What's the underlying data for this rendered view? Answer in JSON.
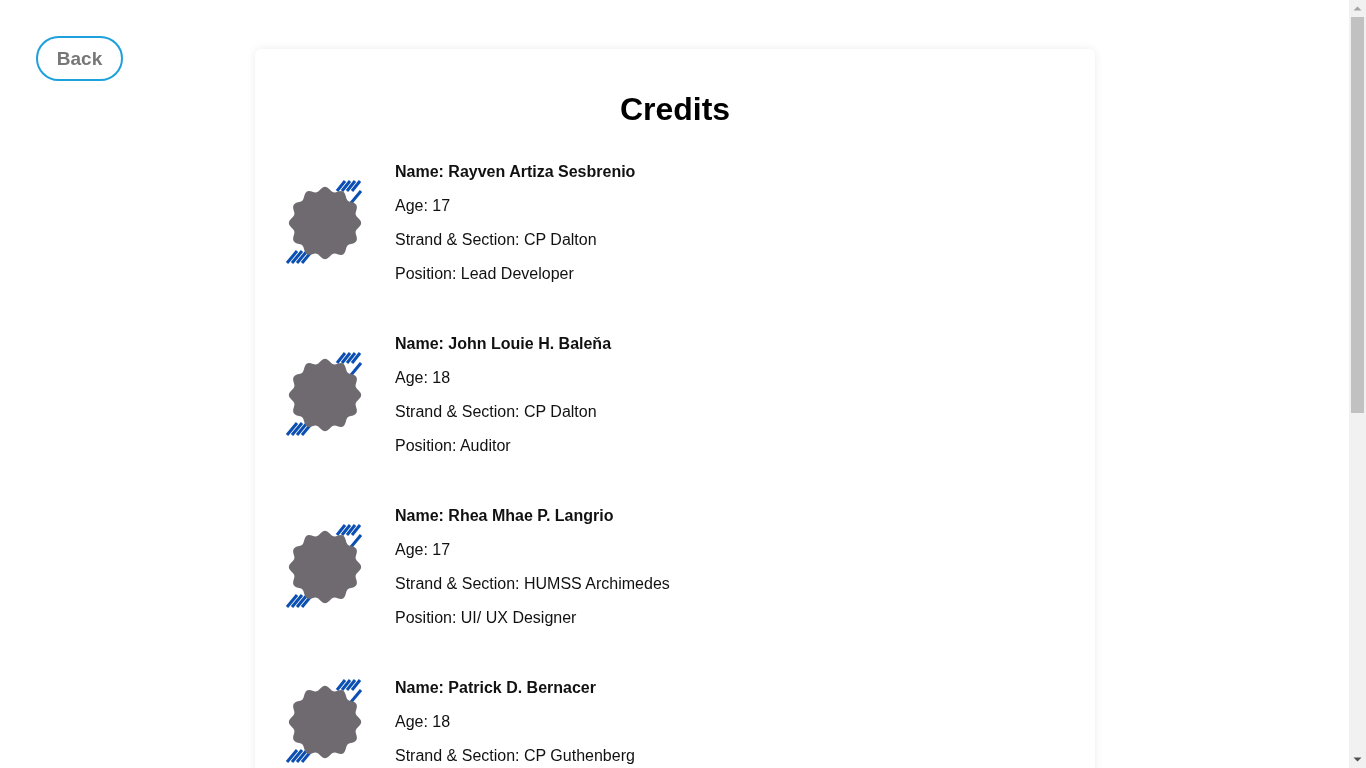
{
  "back_button": {
    "label": "Back"
  },
  "title": "Credits",
  "members": [
    {
      "name": "Name: Rayven Artiza Sesbrenio",
      "details": [
        "Age: 17",
        "Strand & Section: CP Dalton",
        "Position: Lead Developer"
      ]
    },
    {
      "name": "Name: John Louie H. Baleňa",
      "details": [
        "Age: 18",
        "Strand & Section: CP Dalton",
        "Position: Auditor"
      ]
    },
    {
      "name": "Name: Rhea Mhae P. Langrio",
      "details": [
        "Age: 17",
        "Strand & Section: HUMSS Archimedes",
        "Position: UI/ UX Designer"
      ]
    },
    {
      "name": "Name: Patrick D. Bernacer",
      "details": [
        "Age: 18",
        "Strand & Section: CP Guthenberg"
      ]
    }
  ]
}
